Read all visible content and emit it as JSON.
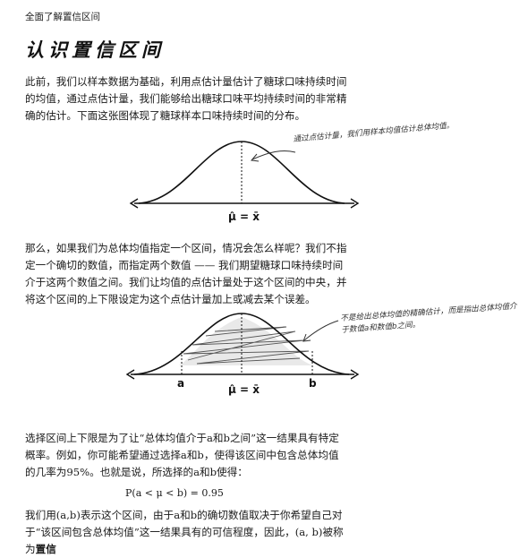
{
  "header": {
    "running_head": "全面了解置信区间"
  },
  "section": {
    "title": "认识置信区间"
  },
  "paragraphs": {
    "p1": "此前，我们以样本数据为基础，利用点估计量估计了糖球口味持续时间的均值，通过点估计量，我们能够给出糖球口味平均持续时间的非常精确的估计。下面这张图体现了糖球样本口味持续时间的分布。",
    "p2": "那么，如果我们为总体均值指定一个区间，情况会怎么样呢？我们不指定一个确切的数值，而指定两个数值 —— 我们期望糖球口味持续时间介于这两个数值之间。我们让均值的点估计量处于这个区间的中央，并将这个区间的上下限设定为这个点估计量加上或减去某个误差。",
    "p3": "选择区间上下限是为了让“总体均值介于a和b之间”这一结果具有特定概率。例如，你可能希望通过选择a和b，使得该区间中包含总体均值的几率为95%。也就是说，所选择的a和b使得：",
    "p4_text": "我们用(a,b)表示这个区间，由于a和b的确切数值取决于你希望自己对于“该区间包含总体均值”这一结果具有的可信程度，因此，(a, b)被称为",
    "p4_bold": "置信"
  },
  "formula": "P(a < μ < b) = 0.95",
  "diagram1": {
    "label": "μ̂ = x̄",
    "annotation": "通过点估计量，我们用样本均值估计总体均值。"
  },
  "diagram2": {
    "label_a": "a",
    "label_b": "b",
    "label_mean": "μ̂ = x̄",
    "annotation": "不是给出总体均值的精确估计，而是指出总体均值介于数值a和数值b之间。"
  }
}
